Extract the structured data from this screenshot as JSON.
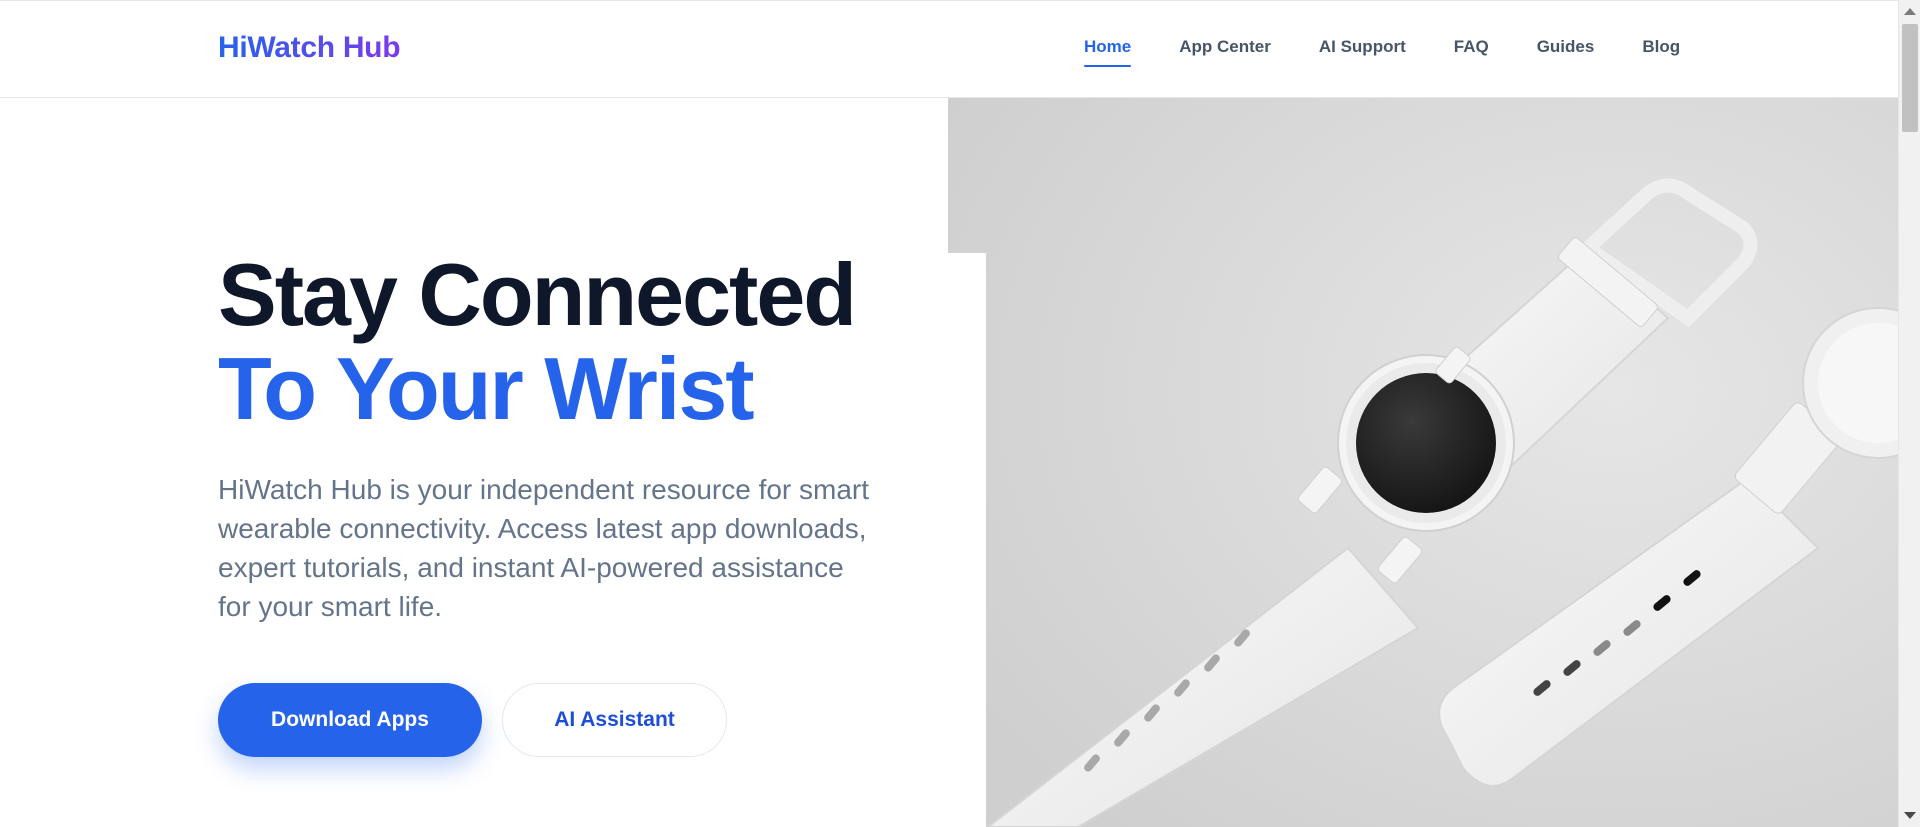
{
  "header": {
    "logo": "HiWatch Hub",
    "nav": [
      {
        "label": "Home",
        "active": true
      },
      {
        "label": "App Center",
        "active": false
      },
      {
        "label": "AI Support",
        "active": false
      },
      {
        "label": "FAQ",
        "active": false
      },
      {
        "label": "Guides",
        "active": false
      },
      {
        "label": "Blog",
        "active": false
      }
    ]
  },
  "hero": {
    "headline_line1": "Stay Connected",
    "headline_line2": "To Your Wrist",
    "description": "HiWatch Hub is your independent resource for smart wearable connectivity. Access latest app downloads, expert tutorials, and instant AI-powered assistance for your smart life.",
    "primary_button": "Download Apps",
    "secondary_button": "AI Assistant",
    "image_subject": "white-smartwatches-on-grey"
  },
  "colors": {
    "brand_blue": "#2563eb",
    "brand_purple": "#7c3aed",
    "heading_dark": "#0f172a",
    "body_gray": "#64748b",
    "nav_gray": "#475569"
  }
}
